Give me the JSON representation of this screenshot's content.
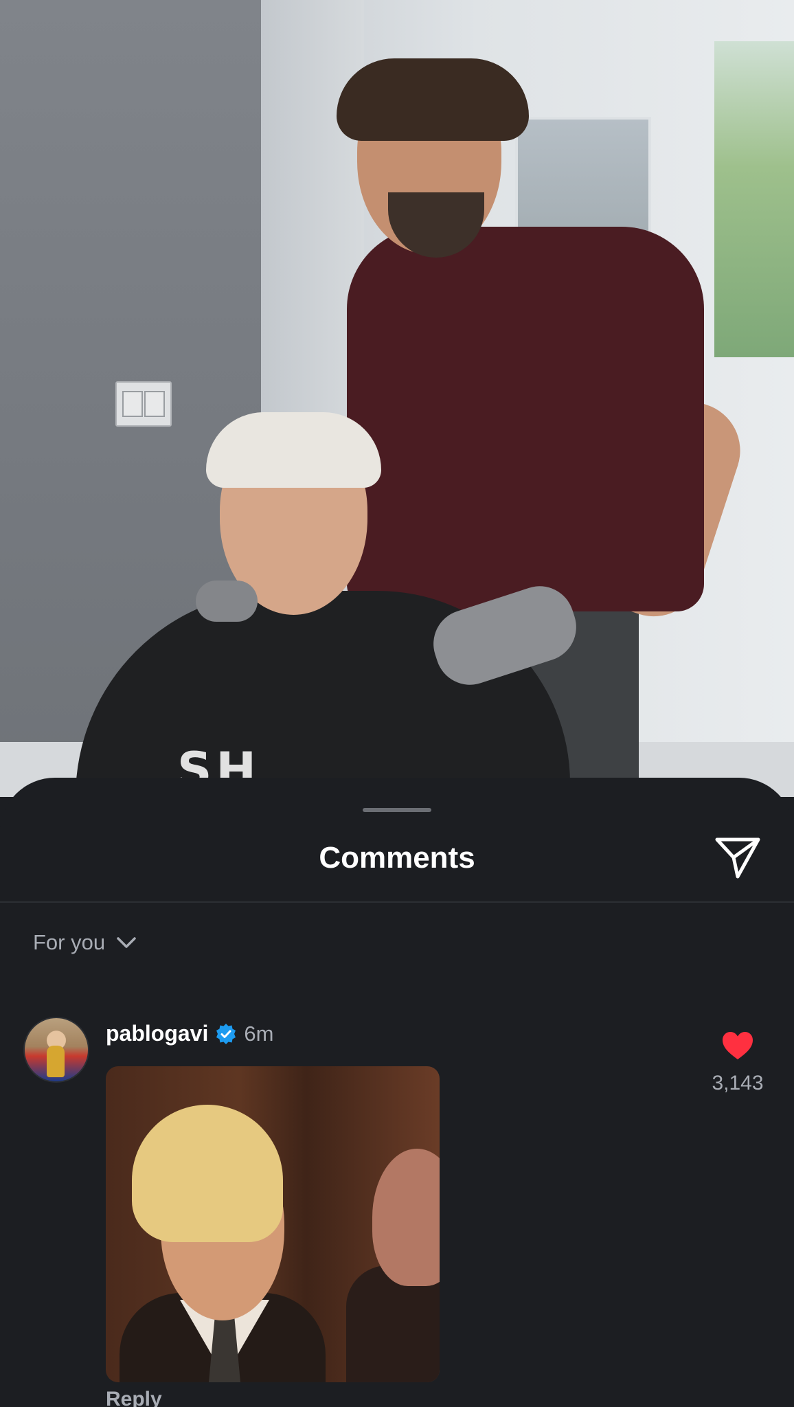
{
  "post_photo": {
    "cape_text": "SH"
  },
  "sheet": {
    "title": "Comments",
    "share_icon": "paper-plane-icon",
    "sort": {
      "label": "For you",
      "icon": "chevron-down-icon"
    }
  },
  "comment": {
    "author": "pablogavi",
    "verified": true,
    "timestamp": "6m",
    "likes": "3,143",
    "liked": true,
    "reply_label": "Reply",
    "heart_color": "#ff3040",
    "verified_color": "#1d9bf0"
  }
}
